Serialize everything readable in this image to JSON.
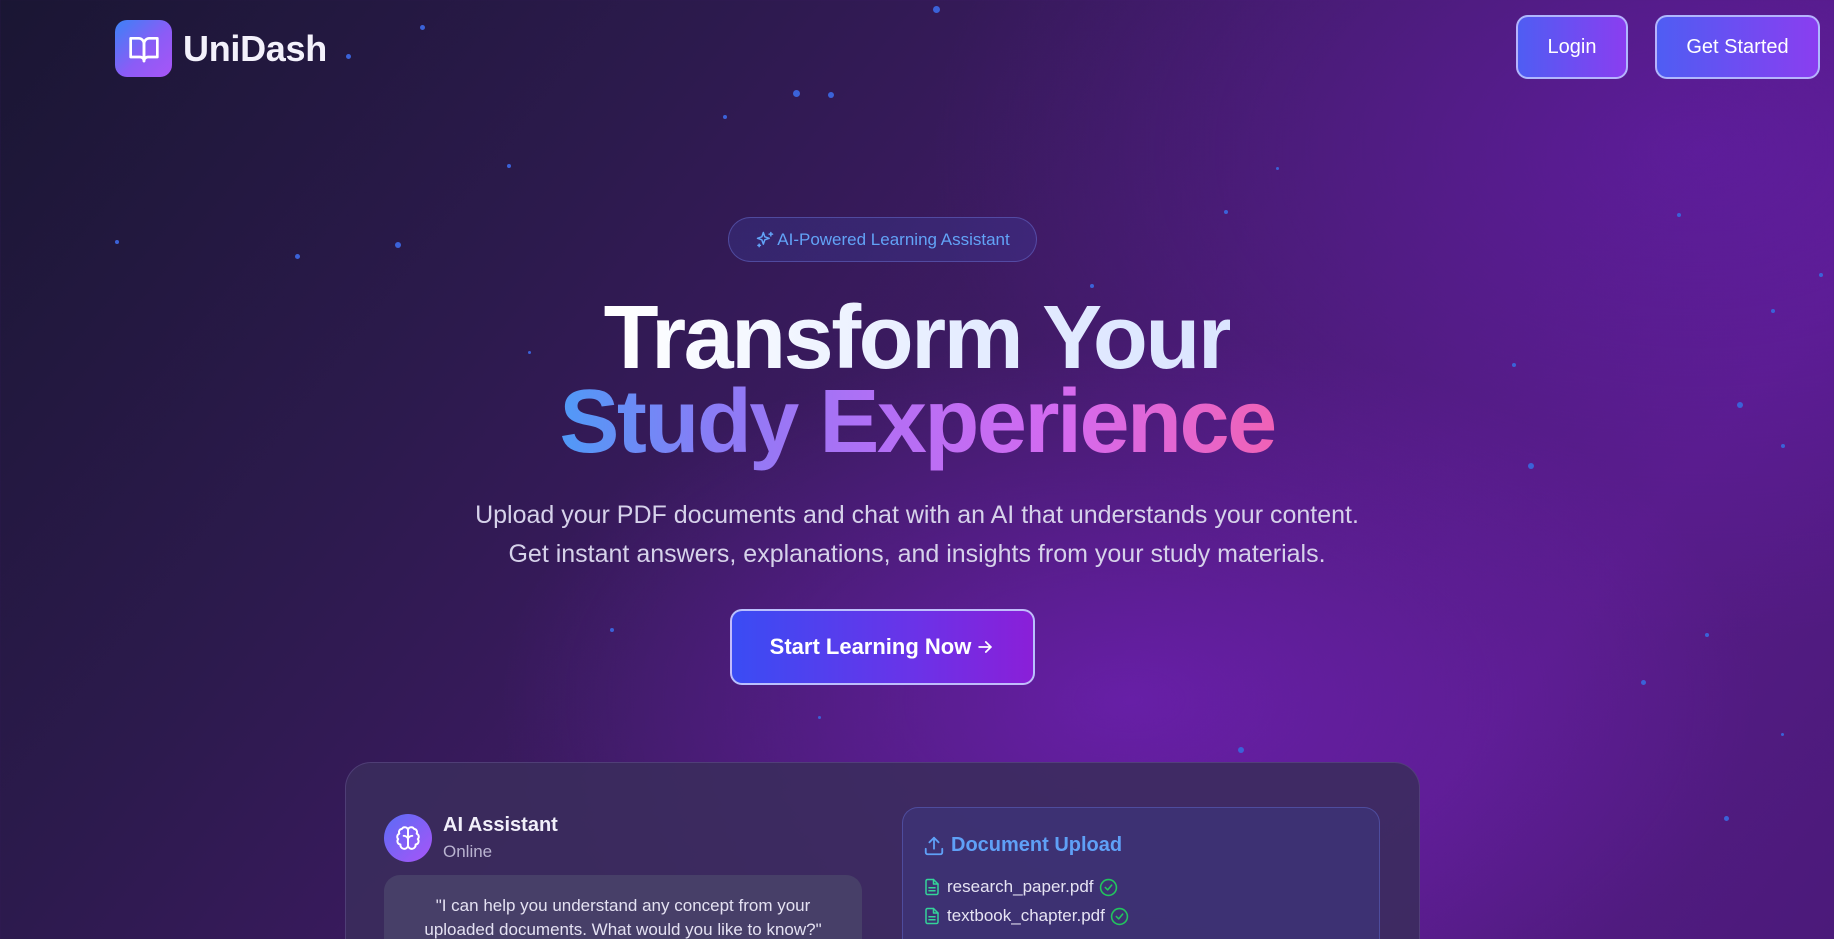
{
  "header": {
    "brand": "UniDash",
    "login_label": "Login",
    "get_started_label": "Get Started"
  },
  "hero": {
    "badge": "AI-Powered Learning Assistant",
    "title_line1": "Transform Your",
    "title_line2": "Study Experience",
    "subtitle_line1": "Upload your PDF documents and chat with an AI that understands your content.",
    "subtitle_line2": "Get instant answers, explanations, and insights from your study materials.",
    "cta_label": "Start Learning Now"
  },
  "preview": {
    "assistant": {
      "name": "AI Assistant",
      "status": "Online",
      "message_line1": "\"I can help you understand any concept from your",
      "message_line2": "uploaded documents. What would you like to know?\""
    },
    "upload": {
      "title": "Document Upload",
      "files": [
        {
          "name": "research_paper.pdf",
          "status": "uploaded"
        },
        {
          "name": "textbook_chapter.pdf",
          "status": "uploaded"
        }
      ]
    }
  },
  "colors": {
    "accent_blue": "#62a3f7",
    "gradient_start": "#4f9af7",
    "gradient_end": "#f062b6",
    "success_green": "#22c55e",
    "file_icon_green": "#34d399"
  },
  "icons": {
    "logo": "book-open-icon",
    "badge": "sparkles-icon",
    "cta": "arrow-right-icon",
    "assistant": "brain-icon",
    "upload": "upload-icon",
    "file": "file-text-icon",
    "file_status": "check-circle-icon"
  }
}
